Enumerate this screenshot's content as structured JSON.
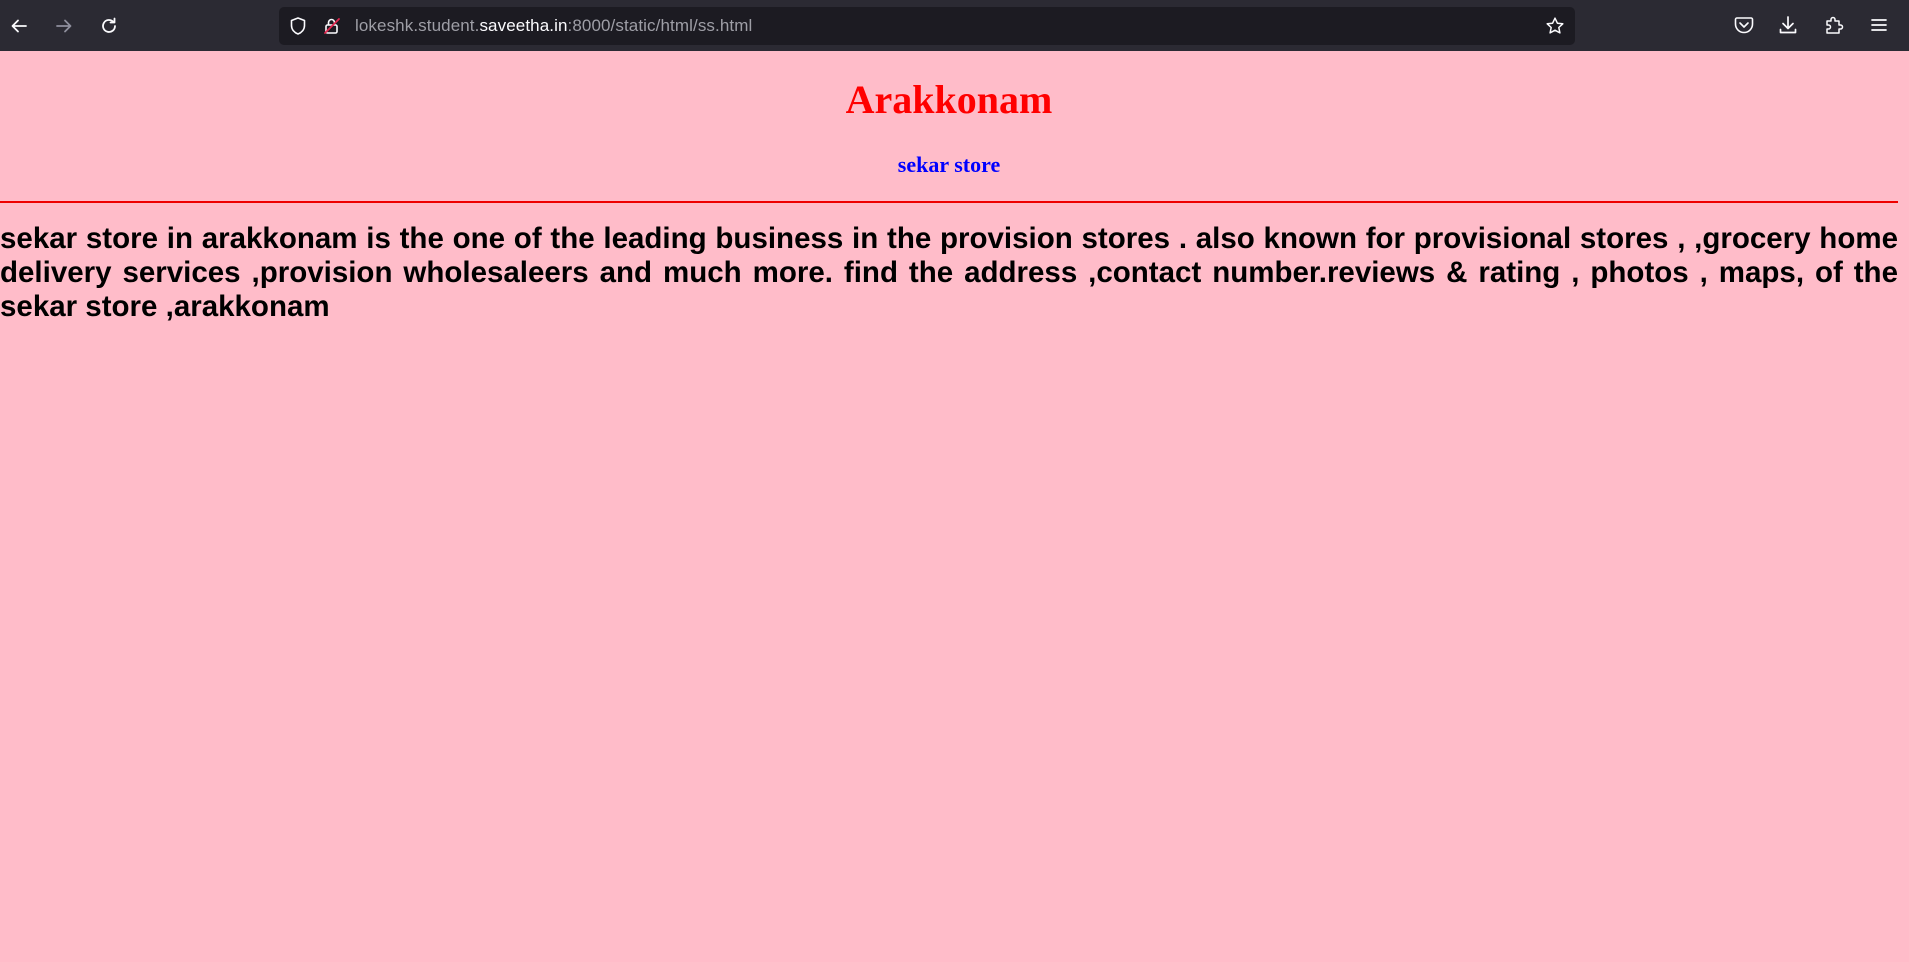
{
  "browser": {
    "url_prefix": "lokeshk.student.",
    "url_host": "saveetha.in",
    "url_suffix": ":8000/static/html/ss.html",
    "colors": {
      "toolbar": "#2b2a33",
      "urlbar": "#1c1b22",
      "icon": "#fbfbfe",
      "icon_disabled": "#8f8f9d"
    },
    "icons": {
      "back": "back-arrow-icon",
      "forward": "forward-arrow-icon",
      "reload": "reload-icon",
      "tracking": "shield-icon",
      "connection": "insecure-lock-icon",
      "bookmark": "star-icon",
      "pocket": "pocket-icon",
      "downloads": "download-icon",
      "extensions": "puzzle-icon",
      "menu": "hamburger-menu-icon"
    }
  },
  "page": {
    "background": "#ffbcc9",
    "title": "Arakkonam",
    "title_color": "#ff0000",
    "subtitle": "sekar store",
    "subtitle_color": "#0000ff",
    "rule_color": "#ee0000",
    "description": "sekar store in arakkonam is the one of the leading business in the provision stores . also known for provisional stores , ,grocery home delivery services ,provision wholesaleers and much more. find the address ,contact number.reviews & rating , photos , maps, of the sekar store ,arakkonam"
  }
}
